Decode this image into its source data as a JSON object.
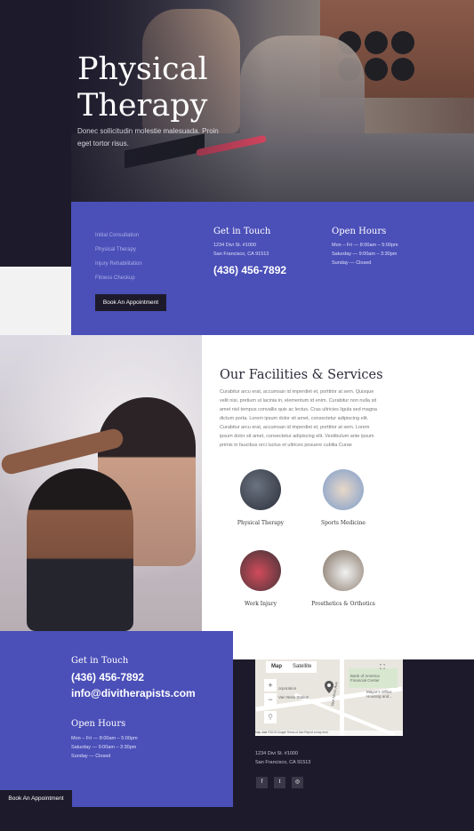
{
  "hero": {
    "title": "Physical Therapy",
    "subtitle": "Donec sollicitudin molestie malesuada. Proin eget tortor risus."
  },
  "info": {
    "services": [
      "Initial Consultation",
      "Physical Therapy",
      "Injury Rehabilitation",
      "Fitness Checkup"
    ],
    "book_label": "Book An Appointment",
    "get_in_touch": {
      "heading": "Get in Touch",
      "address_line1": "1234 Divi St. #1000",
      "address_line2": "San Francisco, CA 91513",
      "phone": "(436) 456-7892"
    },
    "open_hours": {
      "heading": "Open Hours",
      "weekday": "Mon – Fri — 8:00am – 5:00pm",
      "saturday": "Saturday — 9:00am – 3:30pm",
      "sunday": "Sunday — Closed"
    }
  },
  "facilities": {
    "title": "Our Facilities & Services",
    "body": "Curabitur arcu erat, accumsan id imperdiet et, porttitor at sem. Quisque velit nisi, pretium ut lacinia in, elementum id enim. Curabitur non nulla sit amet nisl tempus convallis quis ac lectus. Cras ultricies ligula sed magna dictum porta. Lorem ipsum dolor sit amet, consectetur adipiscing elit. Curabitur arcu erat, accumsan id imperdiet et, porttitor at sem. Lorem ipsum dolor sit amet, consectetur adipiscing elit. Vestibulum ante ipsum primis in faucibus orci luctus et ultrices posuere cubilia Curae",
    "services": [
      {
        "label": "Physical Therapy"
      },
      {
        "label": "Sports Medicine"
      },
      {
        "label": "Work Injury"
      },
      {
        "label": "Prosthetics & Orthotics"
      }
    ]
  },
  "contact": {
    "heading": "Get in Touch",
    "phone": "(436) 456-7892",
    "email": "info@divitherapists.com",
    "hours_heading": "Open Hours",
    "weekday": "Mon – Fri — 8:00am – 5:00pm",
    "saturday": "Saturday — 9:00am – 3:30pm",
    "sunday": "Sunday — Closed",
    "book_label": "Book An Appointment"
  },
  "map": {
    "tab_map": "Map",
    "tab_satellite": "Satellite",
    "zoom_in": "+",
    "zoom_out": "−",
    "label_bank": "Bank of America Financial Center",
    "label_mayor": "Mayor's Office Housing and...",
    "label_corp": "orporation",
    "label_station": "Van Ness Station",
    "label_street": "Van Ness Ave",
    "footer": "Map data ©2019 Google   Terms of Use   Report a map error"
  },
  "footer": {
    "address_line1": "1234 Divi St. #1000",
    "address_line2": "San Francisco, CA 91513",
    "social": [
      {
        "icon": "facebook-icon",
        "glyph": "f"
      },
      {
        "icon": "twitter-icon",
        "glyph": "t"
      },
      {
        "icon": "instagram-icon",
        "glyph": "◎"
      }
    ]
  },
  "colors": {
    "accent": "#4b4fb8",
    "dark": "#1d1b2b",
    "light_bg": "#f2f2f2"
  }
}
